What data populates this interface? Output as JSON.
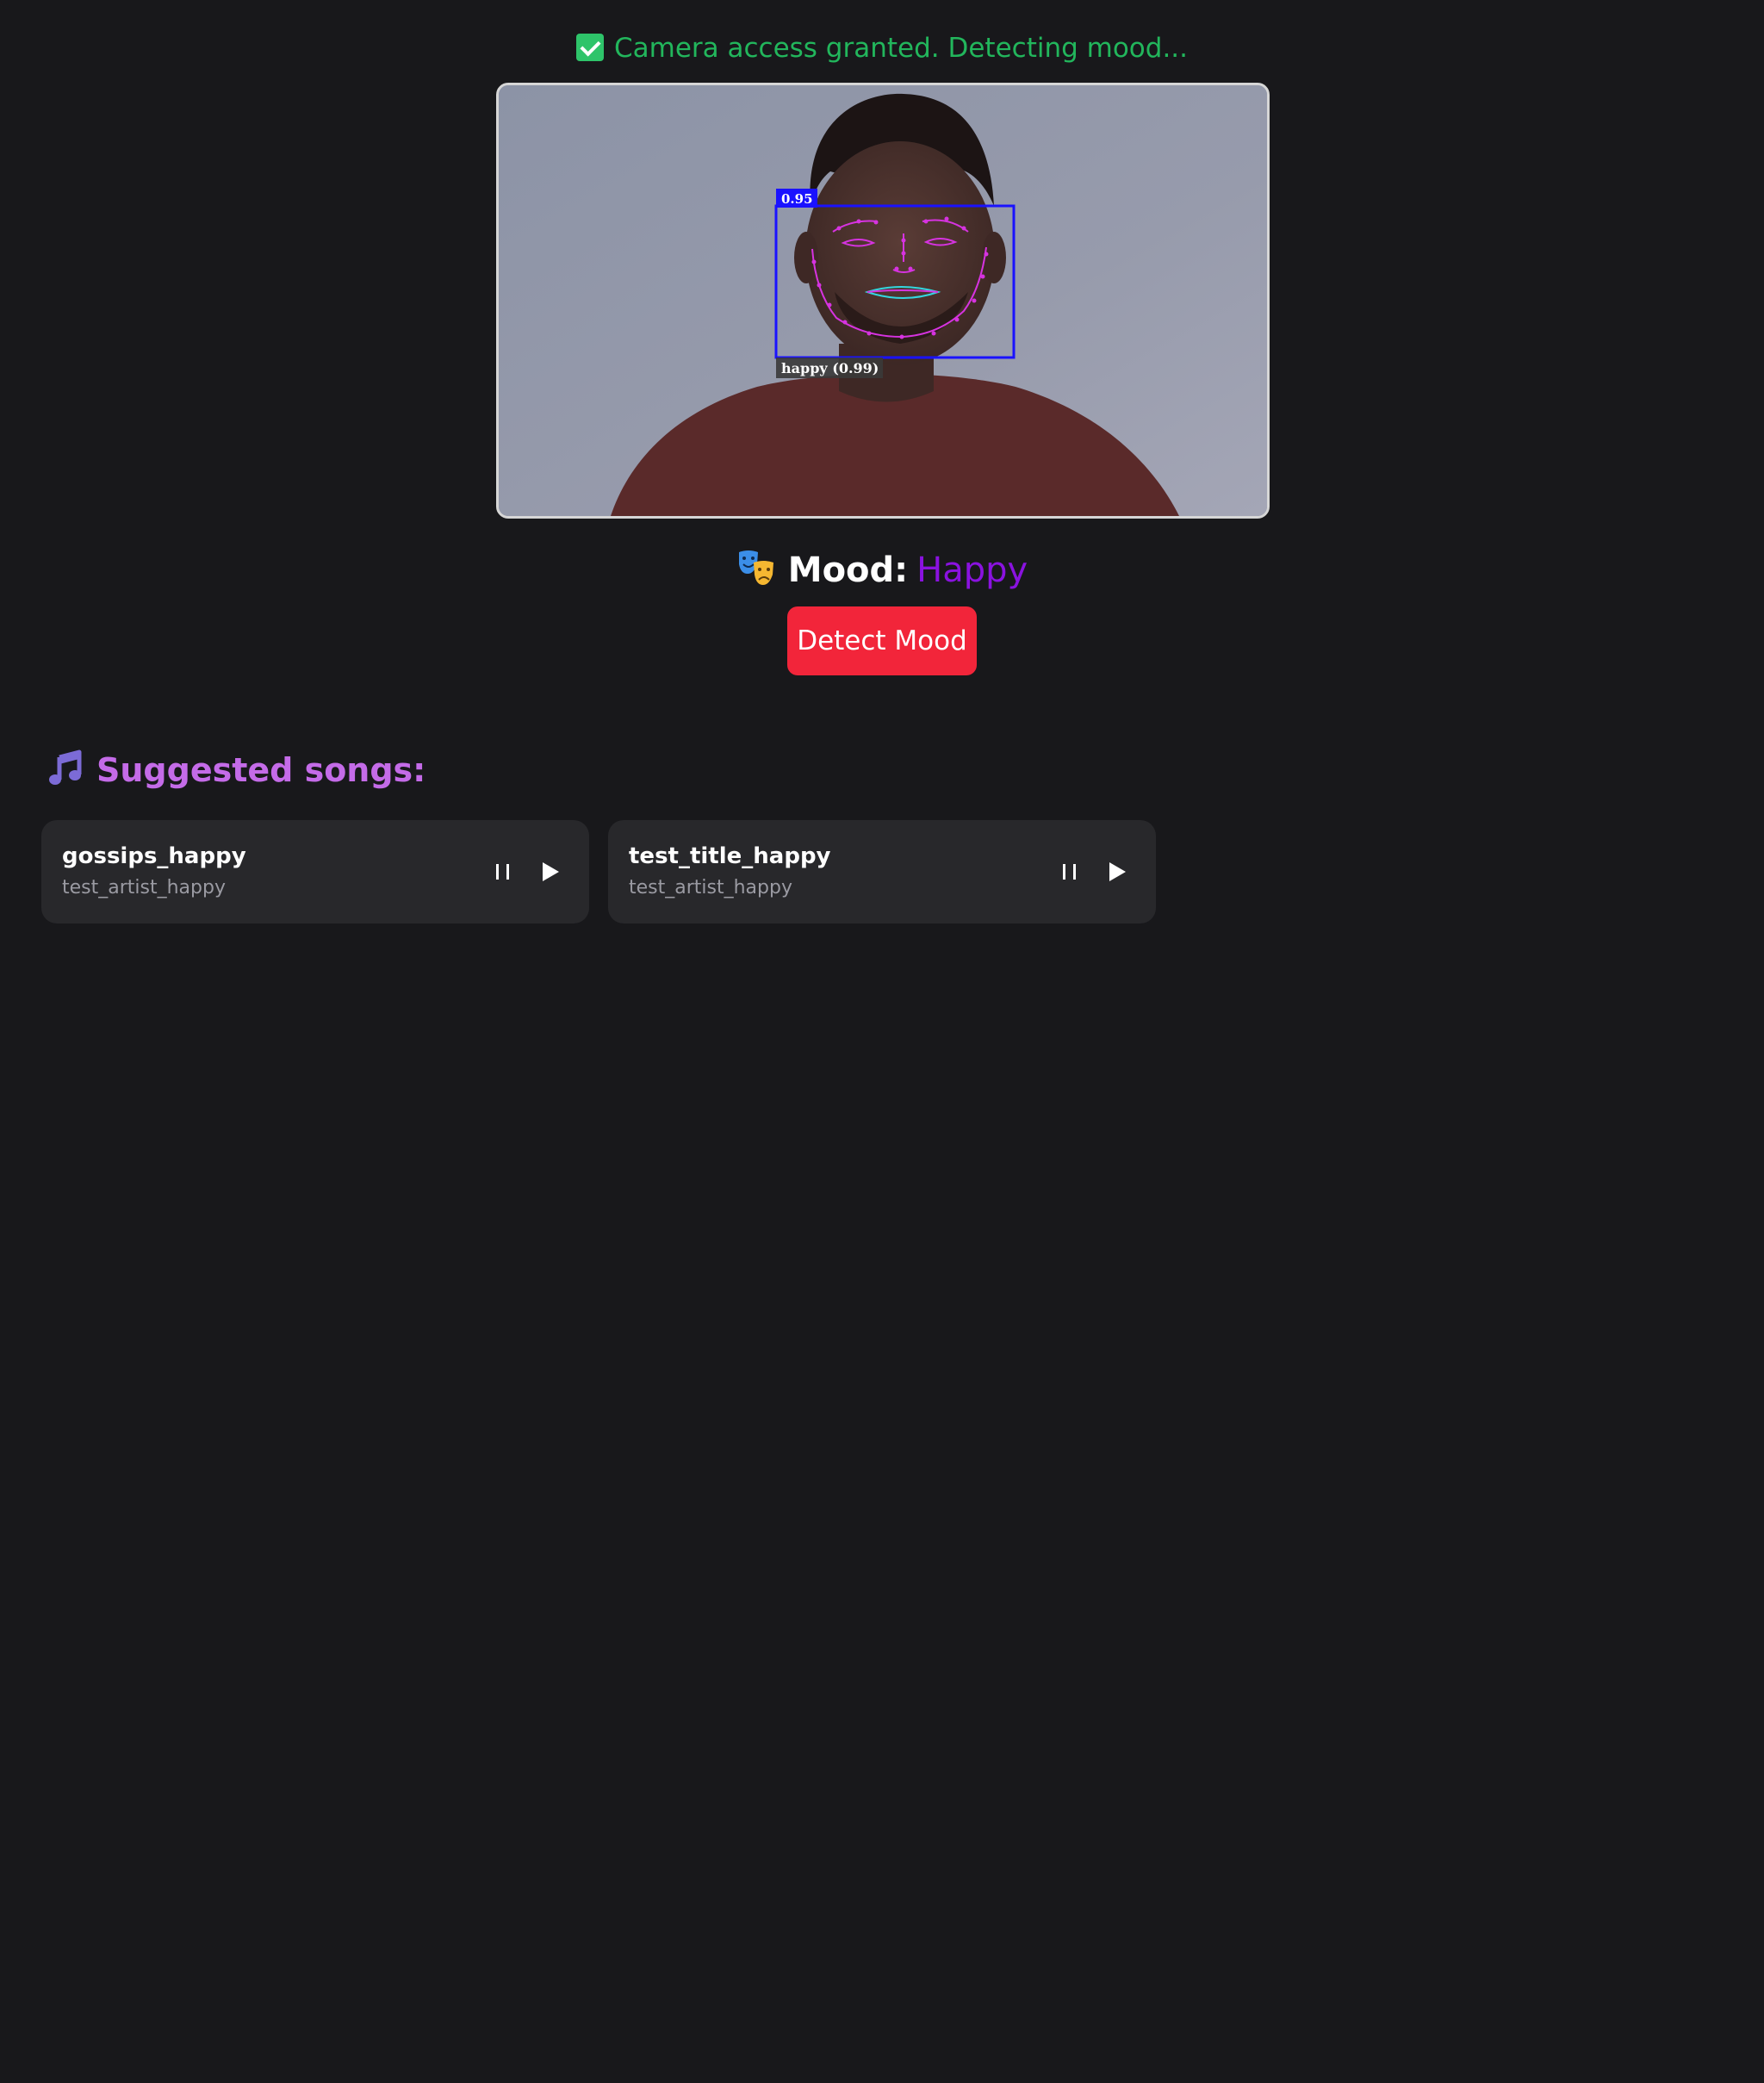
{
  "status": {
    "icon": "checkbox-checked-icon",
    "text": "Camera access granted. Detecting mood...",
    "color": "#22b65c"
  },
  "video": {
    "detection_score": "0.95",
    "expression_label": "happy (0.99)",
    "box_color": "#1a12ff",
    "landmark_color": "#d633e0"
  },
  "mood": {
    "icon": "performing-arts-masks-icon",
    "label": "Mood:",
    "value": "Happy",
    "value_color": "#8a12e0"
  },
  "detect_button": {
    "label": "Detect Mood",
    "color": "#f2253a"
  },
  "songs": {
    "icon": "music-note-icon",
    "heading": "Suggested songs:",
    "heading_color": "#c46be8",
    "items": [
      {
        "title": "gossips_happy",
        "artist": "test_artist_happy"
      },
      {
        "title": "test_title_happy",
        "artist": "test_artist_happy"
      }
    ]
  }
}
